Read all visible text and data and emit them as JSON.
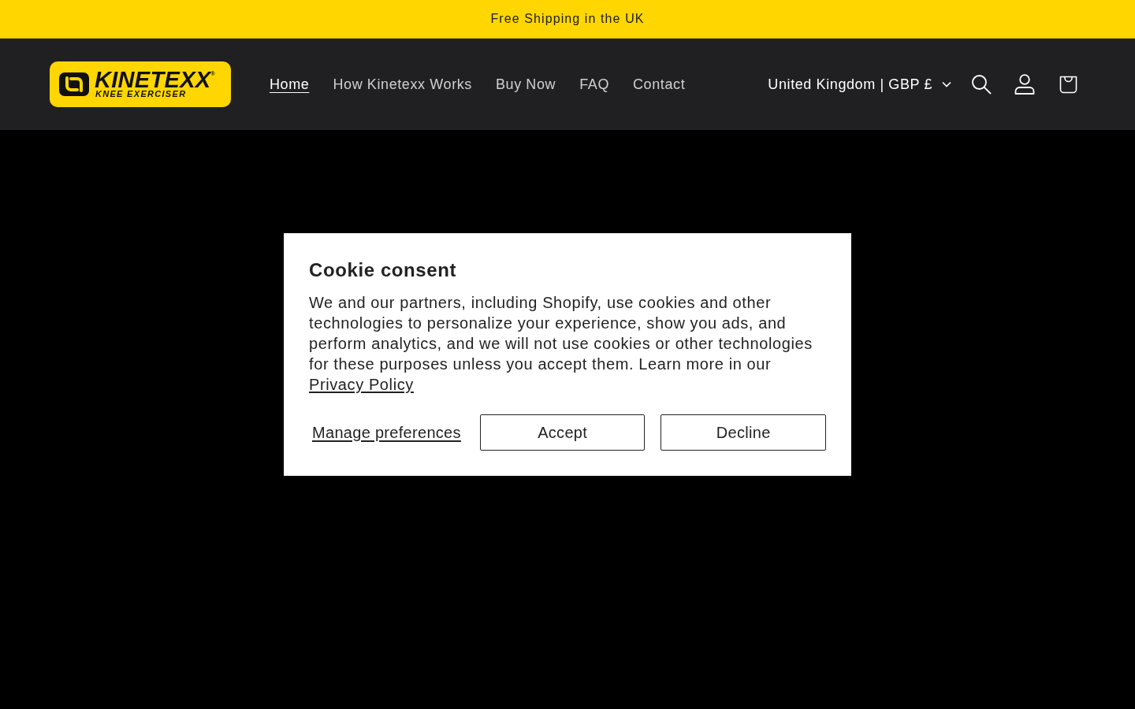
{
  "announcement": {
    "text": "Free Shipping in the UK"
  },
  "header": {
    "logo": {
      "wordmark": "KINETEXX$^{®}$",
      "tagline": "KNEE EXERCISER"
    },
    "nav": [
      {
        "label": "Home",
        "selected": true
      },
      {
        "label": "How Kinetexx Works",
        "selected": false
      },
      {
        "label": "Buy Now",
        "selected": false
      },
      {
        "label": "FAQ",
        "selected": false
      },
      {
        "label": "Contact",
        "selected": false
      }
    ],
    "country_selector": {
      "label": "United Kingdom | GBP £"
    }
  },
  "cookie_dialog": {
    "title": "Cookie consent",
    "text": "We and our partners, including Shopify, use cookies and other technologies to personalize your experience, show you ads, and perform analytics, and we will not use cookies or other technologies for these purposes unless you accept them. Learn more in our",
    "link": "Privacy Policy",
    "buttons": [
      {
        "kind": "link",
        "label": "Manage preferences"
      },
      {
        "kind": "outline",
        "label": "Accept"
      },
      {
        "kind": "outline",
        "label": "Decline"
      }
    ]
  }
}
